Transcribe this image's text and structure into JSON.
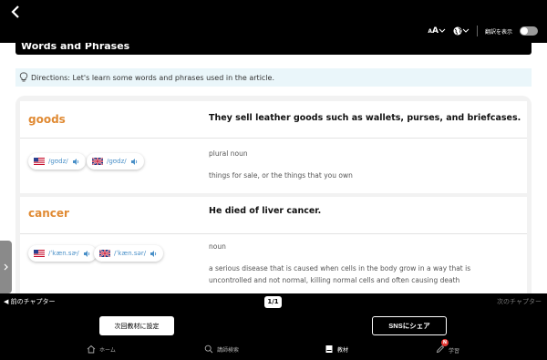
{
  "toolbar": {
    "font_size_label": "A",
    "translation_label": "翻訳を表示",
    "translation_on": false
  },
  "section": {
    "title": "Words and Phrases"
  },
  "directions": {
    "text": "Directions: Let's learn some words and phrases used in the article."
  },
  "words": [
    {
      "word": "goods",
      "sentence": "They sell leather goods such as wallets, purses, and briefcases.",
      "us_ipa": "/ɡʊdz/",
      "uk_ipa": "/ɡʊdz/",
      "part_of_speech": "plural noun",
      "definition": "things for sale, or the things that you own"
    },
    {
      "word": "cancer",
      "sentence": "He died of liver cancer.",
      "us_ipa": "/ˈkæn.sɚ/",
      "uk_ipa": "/ˈkæn.sər/",
      "part_of_speech": "noun",
      "definition": "a serious disease that is caused when cells in the body grow in a way that is uncontrolled and not normal, killing normal cells and often causing death"
    }
  ],
  "chapter_nav": {
    "prev": "前のチャプター",
    "page": "1/1",
    "next": "次のチャプター"
  },
  "actions": {
    "set_next_material": "次回教材に設定",
    "share_sns": "SNSにシェア"
  },
  "bottom_nav": {
    "home": "ホーム",
    "teacher_search": "講師検索",
    "materials": "教材",
    "study": "学習",
    "study_badge": "N"
  },
  "colors": {
    "accent_word": "#e08a33",
    "ipa_blue": "#4a90c8",
    "directions_bg": "#eaf6fa",
    "badge_red": "#e53935"
  },
  "icons": [
    "back-icon",
    "font-size-icon",
    "globe-icon",
    "bulb-icon",
    "speaker-icon",
    "us-flag-icon",
    "uk-flag-icon",
    "home-icon",
    "search-icon",
    "book-icon",
    "pencil-icon"
  ]
}
